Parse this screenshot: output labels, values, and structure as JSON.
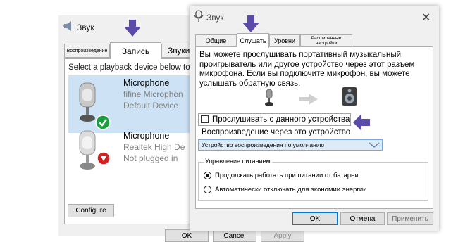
{
  "back_window": {
    "title": "Звук",
    "tabs": [
      {
        "label": "Воспроизведение"
      },
      {
        "label": "Запись"
      },
      {
        "label": "Звуки"
      }
    ],
    "prompt": "Select a playback device below to",
    "devices": [
      {
        "name": "Microphone",
        "sub1": "fifine Microphon",
        "sub2": "Default Device",
        "status": "default-check"
      },
      {
        "name": "Microphone",
        "sub1": "Realtek High De",
        "sub2": "Not plugged in",
        "status": "unplugged"
      }
    ],
    "configure_label": "Configure",
    "buttons": {
      "ok": "OK",
      "cancel": "Cancel",
      "apply": "Apply"
    }
  },
  "front_dialog": {
    "title": "Звук",
    "close_label": "✕",
    "tabs": [
      {
        "label": "Общие"
      },
      {
        "label": "Слушать"
      },
      {
        "label": "Уровни"
      },
      {
        "label": "Расширенные настройки"
      }
    ],
    "description": "Вы можете прослушивать портативный музыкальный проигрыватель или другое устройство через этот разъем микрофона. Если вы подключите микрофон, вы можете услышать обратную связь.",
    "listen_checkbox": {
      "label": "Прослушивать с данного устройства",
      "checked": false
    },
    "playback_through_label": "Воспроизведение через это устройство",
    "playback_device": {
      "value": "Устройство воспроизведения по умолчанию"
    },
    "power": {
      "legend": "Управление питанием",
      "options": [
        {
          "label": "Продолжать работать при питании от батареи",
          "selected": true
        },
        {
          "label": "Автоматически отключать для экономии энергии",
          "selected": false
        }
      ]
    },
    "buttons": {
      "ok": "OK",
      "cancel": "Отмена",
      "apply": "Применить"
    }
  },
  "annotations": {
    "arrow_color": "#5b4aa8"
  },
  "colors": {
    "selection": "#cde3f5",
    "dialog_bg": "#f0f0f0",
    "ok_border": "#0078d7"
  }
}
